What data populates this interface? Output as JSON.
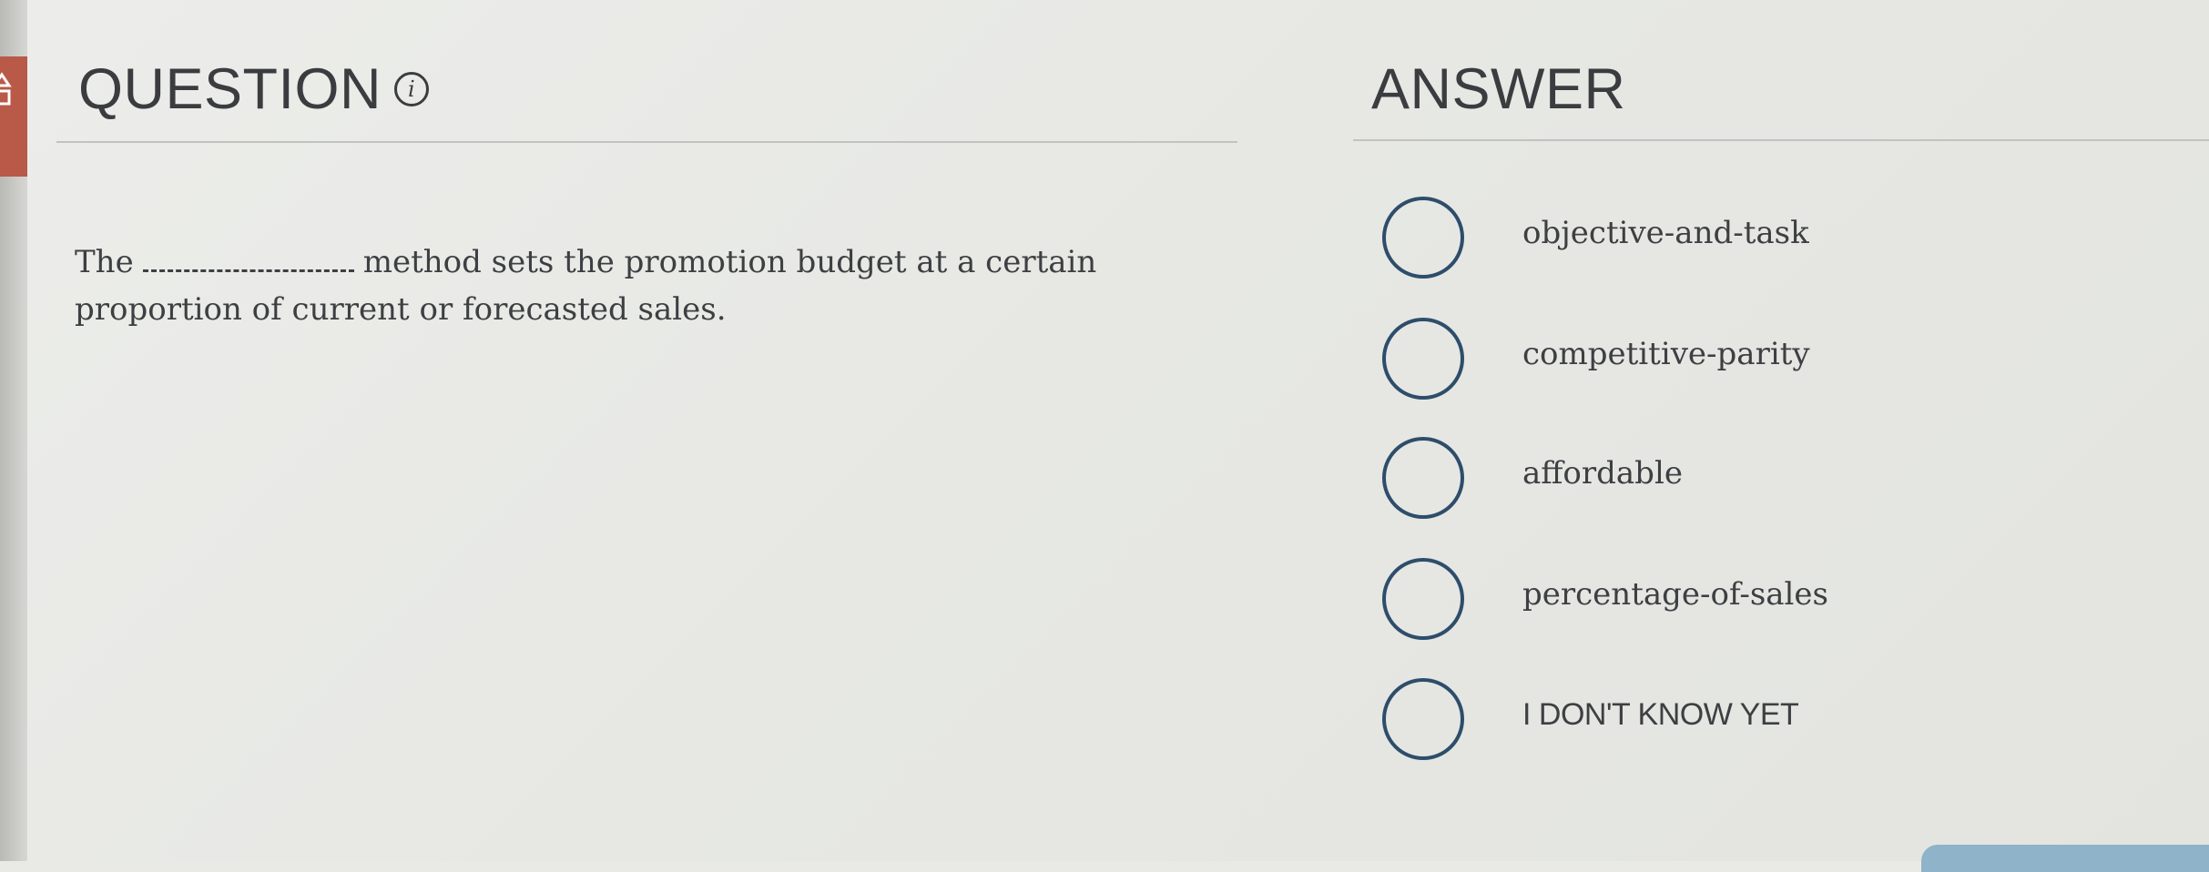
{
  "question": {
    "title": "QUESTION",
    "text_before": "The",
    "text_after": "method sets the promotion budget at a certain proportion of current or forecasted sales."
  },
  "answer": {
    "title": "ANSWER",
    "options": [
      {
        "label": "objective-and-task"
      },
      {
        "label": "competitive-parity"
      },
      {
        "label": "affordable"
      },
      {
        "label": "percentage-of-sales"
      },
      {
        "label": "I DON'T KNOW YET"
      }
    ]
  },
  "icons": {
    "info": "info-icon",
    "sidebar": "shapes-icon"
  },
  "colors": {
    "radio_border": "#2e4d6b",
    "sidebar_tab": "#b85a47",
    "bottom_button": "#8fb3c8"
  }
}
